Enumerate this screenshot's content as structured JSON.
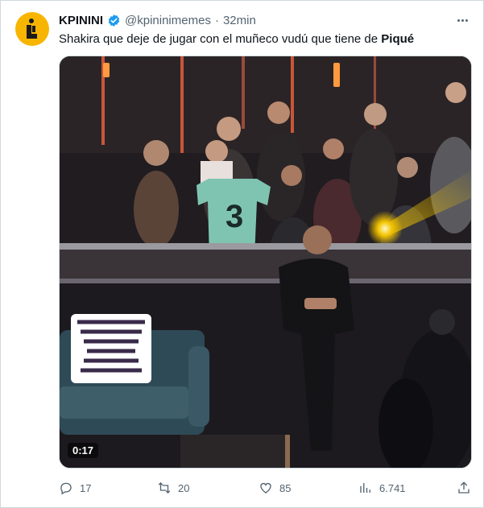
{
  "tweet": {
    "author_name": "KPININI",
    "handle": "@kpininimemes",
    "separator": "·",
    "time": "32min",
    "text_main": "Shakira que deje de jugar con el muñeco vudú que tiene de ",
    "text_bold": "Piqué",
    "avatar_icon": "kpinini-logo-icon",
    "verified_icon": "verified-badge-icon",
    "accent_color": "#1d9bf0",
    "avatar_color": "#f7b500"
  },
  "media": {
    "duration": "0:17",
    "jersey_number": "3"
  },
  "actions": {
    "replies": "17",
    "retweets": "20",
    "likes": "85",
    "views": "6.741"
  }
}
